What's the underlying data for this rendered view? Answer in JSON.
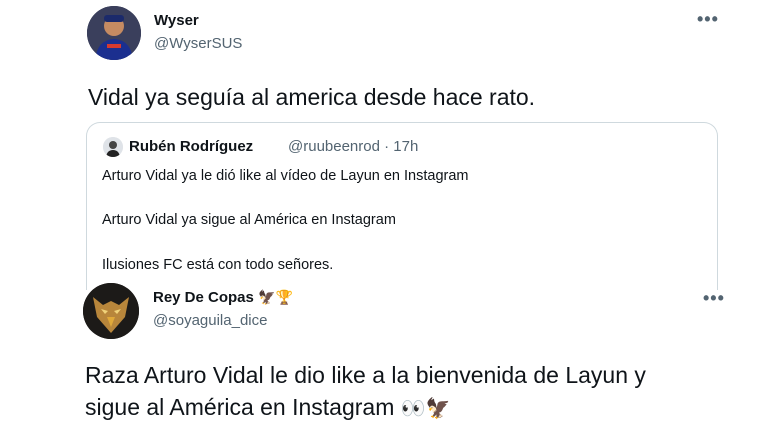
{
  "tweet1": {
    "name": "Wyser",
    "handle": "@WyserSUS",
    "more": "•••",
    "text": "Vidal ya seguía al america desde hace rato.",
    "quote": {
      "name": "Rubén Rodríguez",
      "handle_time": "@ruubeenrod · 17h",
      "lines": [
        "Arturo Vidal ya le dió like al vídeo de Layun en Instagram",
        "Arturo Vidal ya sigue al América en Instagram",
        "Ilusiones FC está con todo señores."
      ]
    }
  },
  "tweet2": {
    "name": "Rey De Copas",
    "name_emoji": "🦅🏆",
    "handle": "@soyaguila_dice",
    "more": "•••",
    "text_line1": "Raza Arturo Vidal le dio like a la bienvenida de Layun y",
    "text_line2": "sigue al América en Instagram",
    "text_emoji": "👀🦅"
  }
}
